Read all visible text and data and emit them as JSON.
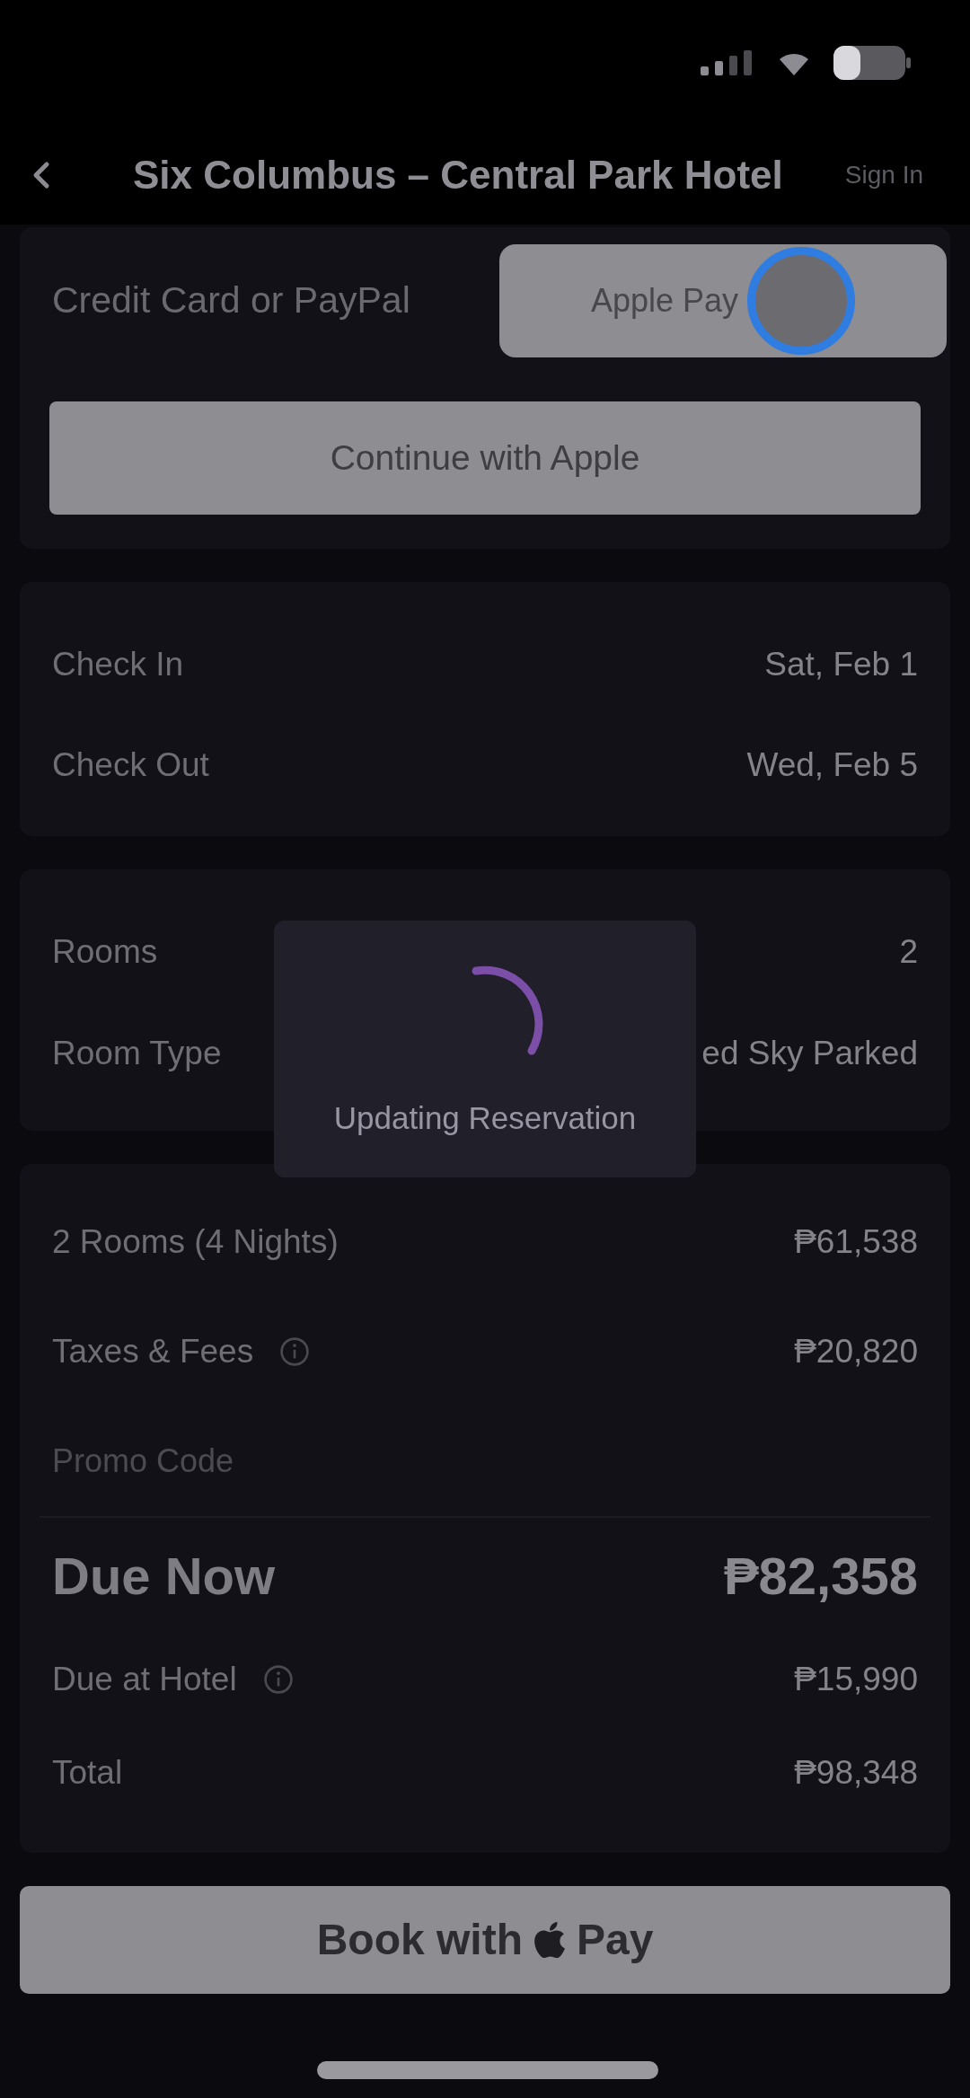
{
  "nav": {
    "title": "Six Columbus – Central Park Hotel",
    "action": "Sign In"
  },
  "payment": {
    "options": [
      {
        "label": "Credit Card or PayPal",
        "selected": false
      },
      {
        "label": "Apple Pay",
        "selected": true
      }
    ],
    "continue_button": "Continue with Apple"
  },
  "stay": [
    {
      "label": "Check In",
      "value": "Sat, Feb 1"
    },
    {
      "label": "Check Out",
      "value": "Wed, Feb 5"
    }
  ],
  "room": [
    {
      "label": "Rooms",
      "value": "2"
    },
    {
      "label": "Room Type",
      "value": "ed Sky Parked"
    }
  ],
  "pricing": [
    {
      "kind": "line",
      "label": "2 Rooms (4 Nights)",
      "value": "₱61,538",
      "info": false
    },
    {
      "kind": "line",
      "label": "Taxes & Fees",
      "value": "₱20,820",
      "info": true
    },
    {
      "kind": "promo",
      "label": "Promo Code"
    },
    {
      "kind": "due",
      "label": "Due Now",
      "value": "₱82,358"
    },
    {
      "kind": "line",
      "label": "Due at Hotel",
      "value": "₱15,990",
      "info": true
    },
    {
      "kind": "line",
      "label": "Total",
      "value": "₱98,348",
      "info": false
    }
  ],
  "loading": {
    "message": "Updating Reservation"
  },
  "book_button": {
    "label_before": "Book with",
    "label_after": "Pay"
  }
}
